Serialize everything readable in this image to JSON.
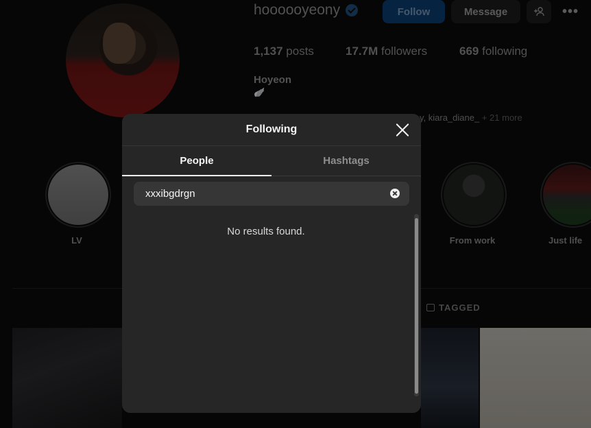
{
  "profile": {
    "username": "hoooooyeony",
    "follow_label": "Follow",
    "message_label": "Message",
    "add_icon_text": "+♂",
    "more_text": "•••",
    "stats": {
      "posts": "1,137",
      "posts_label": "posts",
      "followers": "17.7M",
      "followers_label": "followers",
      "following": "669",
      "following_label": "following"
    },
    "full_name": "Hoyeon",
    "emoji": "🪽",
    "followed_by": "y, kiara_diane_",
    "followed_by_more": "+ 21 more"
  },
  "highlights": [
    {
      "label": "LV"
    },
    {
      "label": "From work"
    },
    {
      "label": "Just life"
    }
  ],
  "tabs_bg": {
    "tagged_label": "TAGGED"
  },
  "modal": {
    "title": "Following",
    "tabs": [
      {
        "label": "People",
        "active": true
      },
      {
        "label": "Hashtags",
        "active": false
      }
    ],
    "search": {
      "value": "xxxibgdrgn",
      "placeholder": "Search"
    },
    "empty_message": "No results found."
  },
  "colors": {
    "modal_bg": "#262626",
    "follow_btn": "#0b3f73",
    "text_primary": "#f5f5f5",
    "text_muted": "#8e8e8e"
  }
}
